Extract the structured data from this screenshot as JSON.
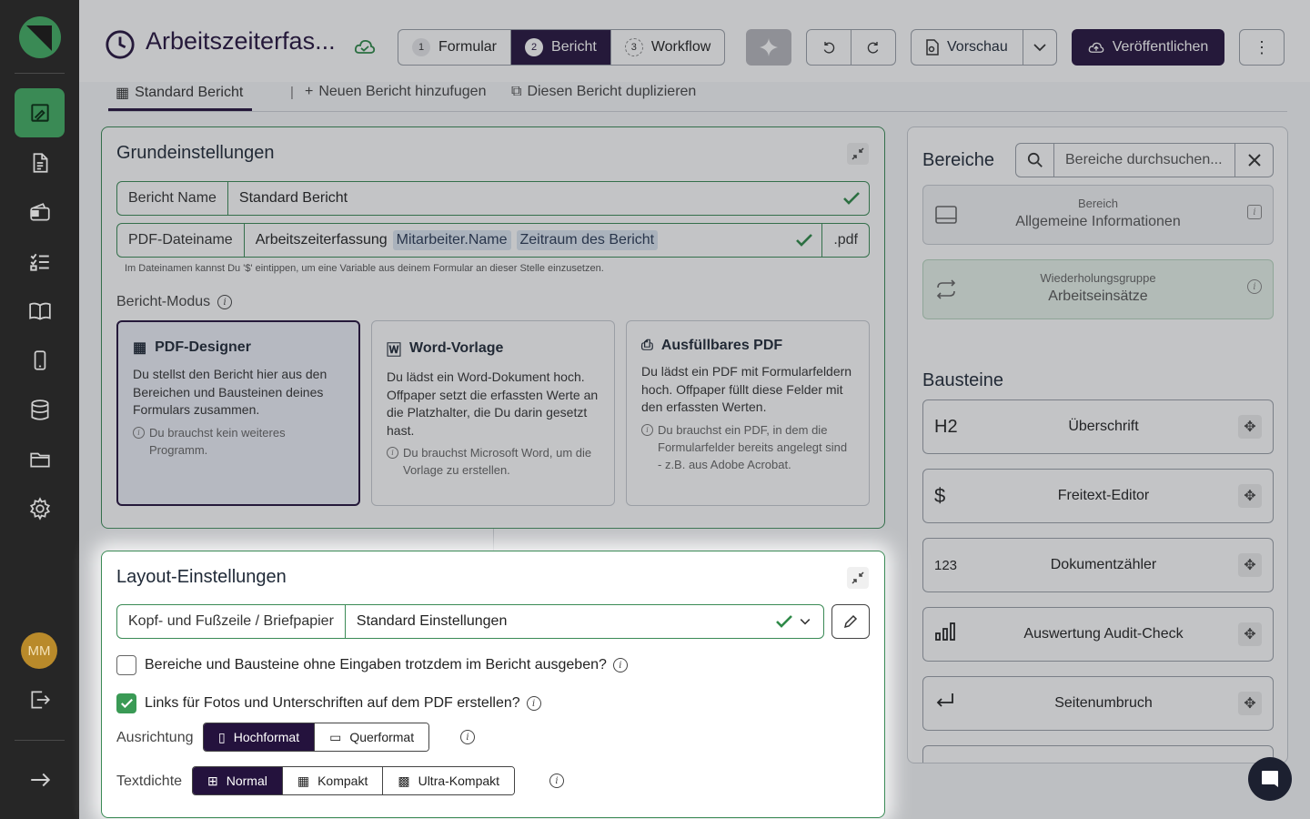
{
  "sidebar": {
    "items": [
      {
        "icon": "report-designer-icon",
        "active": true
      },
      {
        "icon": "document-icon"
      },
      {
        "icon": "wallet-icon"
      },
      {
        "icon": "checklist-icon"
      },
      {
        "icon": "book-icon"
      },
      {
        "icon": "mobile-icon"
      },
      {
        "icon": "database-icon"
      },
      {
        "icon": "folder-icon"
      },
      {
        "icon": "gear-icon"
      }
    ],
    "avatar_initials": "MM",
    "logout_icon": "logout-icon",
    "expand_icon": "arrow-right-icon"
  },
  "header": {
    "title": "Arbeitszeiterfas...",
    "steps": [
      {
        "num": "1",
        "label": "Formular"
      },
      {
        "num": "2",
        "label": "Bericht",
        "active": true
      },
      {
        "num": "3",
        "label": "Workflow"
      }
    ],
    "preview_label": "Vorschau",
    "publish_label": "Veröffentlichen",
    "more_label": "⋮"
  },
  "tabs": {
    "active": "Standard Bericht",
    "separator": "|",
    "add": "Neuen Bericht hinzufugen",
    "duplicate": "Diesen Bericht duplizieren"
  },
  "basic": {
    "title": "Grundeinstellungen",
    "report_name_label": "Bericht Name",
    "report_name_value": "Standard Bericht",
    "pdf_name_label": "PDF-Dateiname",
    "pdf_name_prefix": "Arbeitszeiterfassung",
    "pdf_name_chips": [
      "Mitarbeiter.Name",
      "Zeitraum des Bericht"
    ],
    "pdf_ext": ".pdf",
    "hint": "Im Dateinamen kannst Du '$' eintippen, um eine Variable aus deinem Formular an dieser Stelle einzusetzen.",
    "mode_label": "Bericht-Modus",
    "modes": [
      {
        "title": "PDF-Designer",
        "desc": "Du stellst den Bericht hier aus den Bereichen und Bausteinen deines Formulars zusammen.",
        "note": "Du brauchst kein weiteres Programm.",
        "selected": true
      },
      {
        "title": "Word-Vorlage",
        "desc": "Du lädst ein Word-Dokument hoch. Offpaper setzt die erfassten Werte an die Platzhalter, die Du darin gesetzt hast.",
        "note": "Du brauchst Microsoft Word, um die Vorlage zu erstellen."
      },
      {
        "title": "Ausfüllbares PDF",
        "desc": "Du lädst ein PDF mit Formularfeldern hoch. Offpaper füllt diese Felder mit den erfassten Werten.",
        "note": "Du brauchst ein PDF, in dem die Formularfelder bereits angelegt sind - z.B. aus Adobe Acrobat."
      }
    ]
  },
  "layout": {
    "title": "Layout-Einstellungen",
    "letterhead_label": "Kopf- und Fußzeile / Briefpapier",
    "letterhead_value": "Standard Einstellungen",
    "checkbox1": "Bereiche und Bausteine ohne Eingaben trotzdem im Bericht ausgeben?",
    "checkbox2": "Links für Fotos und Unterschriften auf dem PDF erstellen?",
    "orientation_label": "Ausrichtung",
    "orientation_options": [
      "Hochformat",
      "Querformat"
    ],
    "density_label": "Textdichte",
    "density_options": [
      "Normal",
      "Kompakt",
      "Ultra-Kompakt"
    ]
  },
  "right": {
    "areas_title": "Bereiche",
    "search_placeholder": "Bereiche durchsuchen...",
    "areas": [
      {
        "kind": "Bereich",
        "name": "Allgemeine Informationen"
      },
      {
        "kind": "Wiederholungsgruppe",
        "name": "Arbeitseinsätze"
      }
    ],
    "blocks_title": "Bausteine",
    "blocks": [
      {
        "icon": "H2",
        "label": "Überschrift"
      },
      {
        "icon": "$",
        "label": "Freitext-Editor"
      },
      {
        "icon": "123",
        "label": "Dokumentzähler"
      },
      {
        "icon": "bar-chart-icon",
        "label": "Auswertung Audit-Check"
      },
      {
        "icon": "return-icon",
        "label": "Seitenumbruch"
      }
    ]
  },
  "colors": {
    "primary": "#24123d",
    "accent": "#3a8a55",
    "sidebar": "#262626"
  }
}
